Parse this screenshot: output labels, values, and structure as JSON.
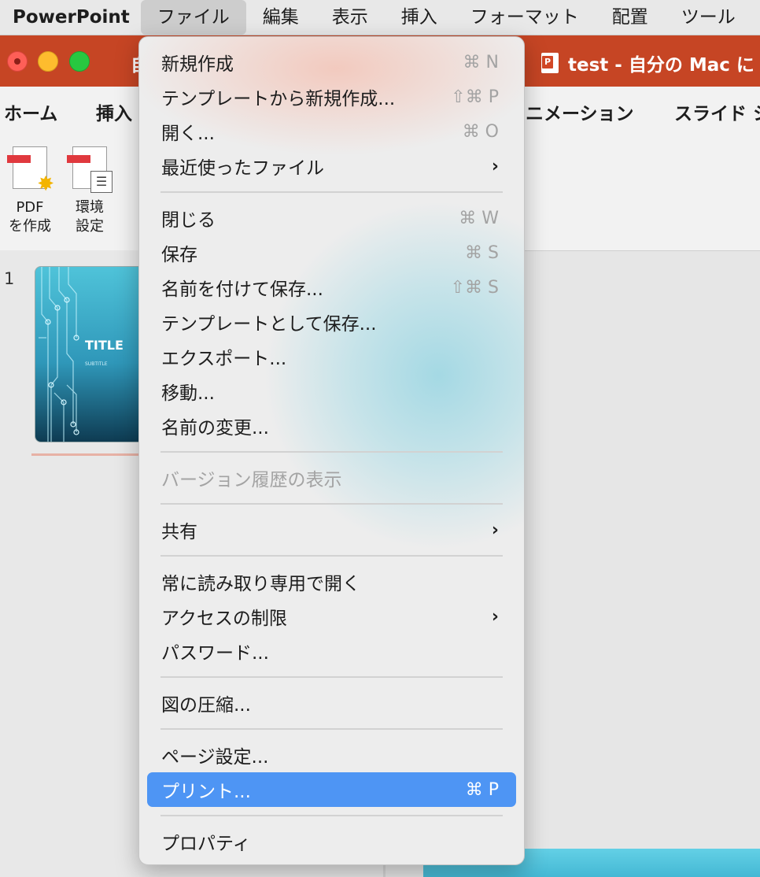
{
  "menubar": {
    "app_name": "PowerPoint",
    "items": [
      "ファイル",
      "編集",
      "表示",
      "挿入",
      "フォーマット",
      "配置",
      "ツール"
    ]
  },
  "window": {
    "title": "test - 自分の Mac に",
    "left_title_fragment": "自"
  },
  "ribbon": {
    "tabs": [
      "ホーム",
      "挿入",
      "ニメーション",
      "スライド シ"
    ],
    "buttons": [
      {
        "line1": "PDF",
        "line2": "を作成"
      },
      {
        "line1": "環境",
        "line2": "設定"
      }
    ]
  },
  "slide_panel": {
    "slide_number": "1",
    "thumb_title": "TITLE",
    "thumb_subtitle": "SUBTITLE"
  },
  "file_menu": {
    "items": [
      {
        "label": "新規作成",
        "shortcut": "⌘ N"
      },
      {
        "label": "テンプレートから新規作成...",
        "shortcut": "⇧⌘ P"
      },
      {
        "label": "開く...",
        "shortcut": "⌘ O"
      },
      {
        "label": "最近使ったファイル",
        "submenu": "›"
      },
      {
        "label": "閉じる",
        "shortcut": "⌘ W"
      },
      {
        "label": "保存",
        "shortcut": "⌘ S"
      },
      {
        "label": "名前を付けて保存...",
        "shortcut": "⇧⌘ S"
      },
      {
        "label": "テンプレートとして保存..."
      },
      {
        "label": "エクスポート..."
      },
      {
        "label": "移動..."
      },
      {
        "label": "名前の変更..."
      },
      {
        "label": "バージョン履歴の表示"
      },
      {
        "label": "共有",
        "submenu": "›"
      },
      {
        "label": "常に読み取り専用で開く"
      },
      {
        "label": "アクセスの制限",
        "submenu": "›"
      },
      {
        "label": "パスワード..."
      },
      {
        "label": "図の圧縮..."
      },
      {
        "label": "ページ設定..."
      },
      {
        "label": "プリント...",
        "shortcut": "⌘ P"
      },
      {
        "label": "プロパティ"
      }
    ]
  },
  "colors": {
    "title_bar": "#c64524",
    "highlight": "#4e95f4"
  }
}
